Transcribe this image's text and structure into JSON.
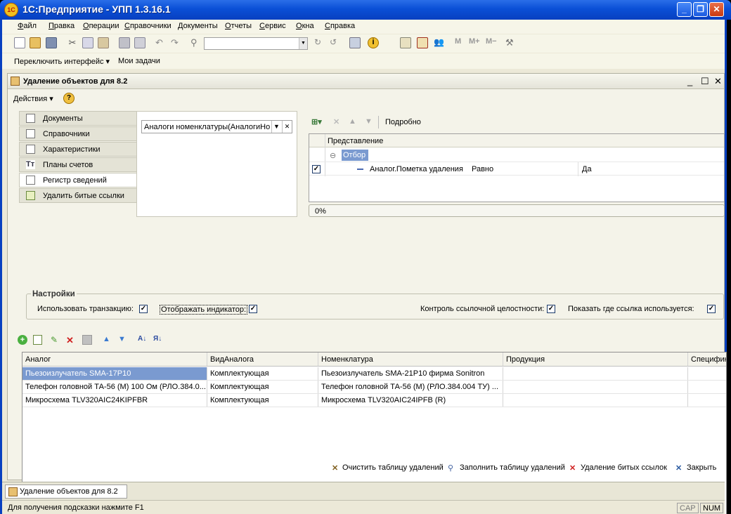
{
  "window": {
    "title": "1С:Предприятие - УПП 1.3.16.1",
    "logo": "1С"
  },
  "menu": [
    "Файл",
    "Правка",
    "Операции",
    "Справочники",
    "Документы",
    "Отчеты",
    "Сервис",
    "Окна",
    "Справка"
  ],
  "toolbar2": {
    "switch_interface": "Переключить интерфейс ▾",
    "my_tasks": "Мои задачи"
  },
  "document": {
    "title": "Удаление объектов для 8.2",
    "actions": "Действия ▾",
    "tabs": [
      "Документы",
      "Справочники",
      "Характеристики",
      "Планы счетов",
      "Регистр сведений",
      "Удалить битые ссылки"
    ],
    "active_tab": 4,
    "register_select": "Аналоги номенклатуры(АналогиНо",
    "filter": {
      "details_label": "Подробно",
      "header": "Представление",
      "group": "Отбор",
      "row": {
        "field": "Аналог.Пометка удаления",
        "condition": "Равно",
        "value": "Да",
        "checked": true
      }
    },
    "progress": "0%",
    "settings": {
      "legend": "Настройки",
      "use_transaction": "Использовать транзакцию:",
      "show_indicator": "Отображать индикатор:",
      "ref_integrity": "Контроль ссылочной целостности:",
      "show_usage": "Показать где ссылка используется:"
    },
    "grid": {
      "columns": [
        "Аналог",
        "ВидАналога",
        "Номенклатура",
        "Продукция",
        "Специфик"
      ],
      "rows": [
        [
          "Пьезоизлучатель SMA-17P10",
          "Комплектующая",
          "Пьезоизлучатель SMA-21P10 фирма Sonitron",
          "",
          ""
        ],
        [
          "Телефон головной ТА-56 (М) 100 Ом (РЛО.384.0...",
          "Комплектующая",
          "Телефон головной ТА-56 (М) (РЛО.384.004 ТУ) ...",
          "",
          ""
        ],
        [
          "Микросхема TLV320AIC24KIPFBR",
          "Комплектующая",
          "Микросхема TLV320AIC24IPFB (R)",
          "",
          ""
        ]
      ]
    },
    "buttons": {
      "clear": "Очистить таблицу удалений",
      "fill": "Заполнить таблицу удалений",
      "delete_broken": "Удаление битых ссылок",
      "close": "Закрыть"
    }
  },
  "taskbar": {
    "item": "Удаление объектов для 8.2"
  },
  "status": {
    "hint": "Для получения подсказки нажмите F1",
    "cap": "CAP",
    "num": "NUM"
  }
}
